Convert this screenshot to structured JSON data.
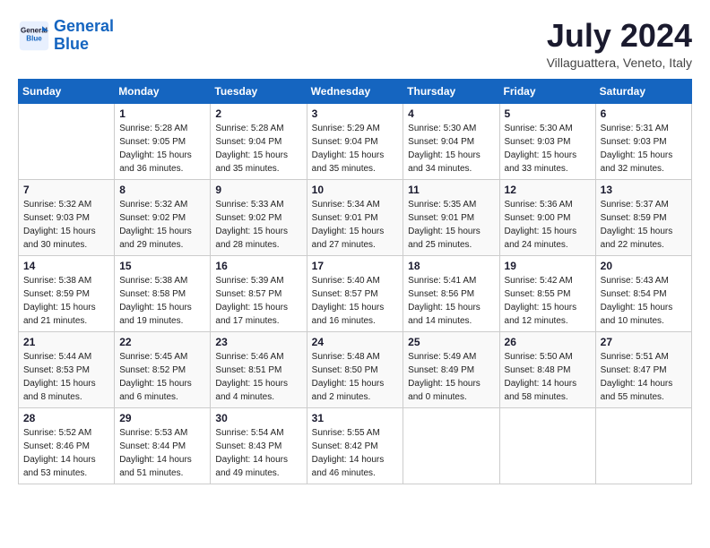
{
  "logo": {
    "line1": "General",
    "line2": "Blue"
  },
  "title": "July 2024",
  "subtitle": "Villaguattera, Veneto, Italy",
  "weekdays": [
    "Sunday",
    "Monday",
    "Tuesday",
    "Wednesday",
    "Thursday",
    "Friday",
    "Saturday"
  ],
  "weeks": [
    [
      {
        "day": "",
        "sunrise": "",
        "sunset": "",
        "daylight": ""
      },
      {
        "day": "1",
        "sunrise": "Sunrise: 5:28 AM",
        "sunset": "Sunset: 9:05 PM",
        "daylight": "Daylight: 15 hours and 36 minutes."
      },
      {
        "day": "2",
        "sunrise": "Sunrise: 5:28 AM",
        "sunset": "Sunset: 9:04 PM",
        "daylight": "Daylight: 15 hours and 35 minutes."
      },
      {
        "day": "3",
        "sunrise": "Sunrise: 5:29 AM",
        "sunset": "Sunset: 9:04 PM",
        "daylight": "Daylight: 15 hours and 35 minutes."
      },
      {
        "day": "4",
        "sunrise": "Sunrise: 5:30 AM",
        "sunset": "Sunset: 9:04 PM",
        "daylight": "Daylight: 15 hours and 34 minutes."
      },
      {
        "day": "5",
        "sunrise": "Sunrise: 5:30 AM",
        "sunset": "Sunset: 9:03 PM",
        "daylight": "Daylight: 15 hours and 33 minutes."
      },
      {
        "day": "6",
        "sunrise": "Sunrise: 5:31 AM",
        "sunset": "Sunset: 9:03 PM",
        "daylight": "Daylight: 15 hours and 32 minutes."
      }
    ],
    [
      {
        "day": "7",
        "sunrise": "Sunrise: 5:32 AM",
        "sunset": "Sunset: 9:03 PM",
        "daylight": "Daylight: 15 hours and 30 minutes."
      },
      {
        "day": "8",
        "sunrise": "Sunrise: 5:32 AM",
        "sunset": "Sunset: 9:02 PM",
        "daylight": "Daylight: 15 hours and 29 minutes."
      },
      {
        "day": "9",
        "sunrise": "Sunrise: 5:33 AM",
        "sunset": "Sunset: 9:02 PM",
        "daylight": "Daylight: 15 hours and 28 minutes."
      },
      {
        "day": "10",
        "sunrise": "Sunrise: 5:34 AM",
        "sunset": "Sunset: 9:01 PM",
        "daylight": "Daylight: 15 hours and 27 minutes."
      },
      {
        "day": "11",
        "sunrise": "Sunrise: 5:35 AM",
        "sunset": "Sunset: 9:01 PM",
        "daylight": "Daylight: 15 hours and 25 minutes."
      },
      {
        "day": "12",
        "sunrise": "Sunrise: 5:36 AM",
        "sunset": "Sunset: 9:00 PM",
        "daylight": "Daylight: 15 hours and 24 minutes."
      },
      {
        "day": "13",
        "sunrise": "Sunrise: 5:37 AM",
        "sunset": "Sunset: 8:59 PM",
        "daylight": "Daylight: 15 hours and 22 minutes."
      }
    ],
    [
      {
        "day": "14",
        "sunrise": "Sunrise: 5:38 AM",
        "sunset": "Sunset: 8:59 PM",
        "daylight": "Daylight: 15 hours and 21 minutes."
      },
      {
        "day": "15",
        "sunrise": "Sunrise: 5:38 AM",
        "sunset": "Sunset: 8:58 PM",
        "daylight": "Daylight: 15 hours and 19 minutes."
      },
      {
        "day": "16",
        "sunrise": "Sunrise: 5:39 AM",
        "sunset": "Sunset: 8:57 PM",
        "daylight": "Daylight: 15 hours and 17 minutes."
      },
      {
        "day": "17",
        "sunrise": "Sunrise: 5:40 AM",
        "sunset": "Sunset: 8:57 PM",
        "daylight": "Daylight: 15 hours and 16 minutes."
      },
      {
        "day": "18",
        "sunrise": "Sunrise: 5:41 AM",
        "sunset": "Sunset: 8:56 PM",
        "daylight": "Daylight: 15 hours and 14 minutes."
      },
      {
        "day": "19",
        "sunrise": "Sunrise: 5:42 AM",
        "sunset": "Sunset: 8:55 PM",
        "daylight": "Daylight: 15 hours and 12 minutes."
      },
      {
        "day": "20",
        "sunrise": "Sunrise: 5:43 AM",
        "sunset": "Sunset: 8:54 PM",
        "daylight": "Daylight: 15 hours and 10 minutes."
      }
    ],
    [
      {
        "day": "21",
        "sunrise": "Sunrise: 5:44 AM",
        "sunset": "Sunset: 8:53 PM",
        "daylight": "Daylight: 15 hours and 8 minutes."
      },
      {
        "day": "22",
        "sunrise": "Sunrise: 5:45 AM",
        "sunset": "Sunset: 8:52 PM",
        "daylight": "Daylight: 15 hours and 6 minutes."
      },
      {
        "day": "23",
        "sunrise": "Sunrise: 5:46 AM",
        "sunset": "Sunset: 8:51 PM",
        "daylight": "Daylight: 15 hours and 4 minutes."
      },
      {
        "day": "24",
        "sunrise": "Sunrise: 5:48 AM",
        "sunset": "Sunset: 8:50 PM",
        "daylight": "Daylight: 15 hours and 2 minutes."
      },
      {
        "day": "25",
        "sunrise": "Sunrise: 5:49 AM",
        "sunset": "Sunset: 8:49 PM",
        "daylight": "Daylight: 15 hours and 0 minutes."
      },
      {
        "day": "26",
        "sunrise": "Sunrise: 5:50 AM",
        "sunset": "Sunset: 8:48 PM",
        "daylight": "Daylight: 14 hours and 58 minutes."
      },
      {
        "day": "27",
        "sunrise": "Sunrise: 5:51 AM",
        "sunset": "Sunset: 8:47 PM",
        "daylight": "Daylight: 14 hours and 55 minutes."
      }
    ],
    [
      {
        "day": "28",
        "sunrise": "Sunrise: 5:52 AM",
        "sunset": "Sunset: 8:46 PM",
        "daylight": "Daylight: 14 hours and 53 minutes."
      },
      {
        "day": "29",
        "sunrise": "Sunrise: 5:53 AM",
        "sunset": "Sunset: 8:44 PM",
        "daylight": "Daylight: 14 hours and 51 minutes."
      },
      {
        "day": "30",
        "sunrise": "Sunrise: 5:54 AM",
        "sunset": "Sunset: 8:43 PM",
        "daylight": "Daylight: 14 hours and 49 minutes."
      },
      {
        "day": "31",
        "sunrise": "Sunrise: 5:55 AM",
        "sunset": "Sunset: 8:42 PM",
        "daylight": "Daylight: 14 hours and 46 minutes."
      },
      {
        "day": "",
        "sunrise": "",
        "sunset": "",
        "daylight": ""
      },
      {
        "day": "",
        "sunrise": "",
        "sunset": "",
        "daylight": ""
      },
      {
        "day": "",
        "sunrise": "",
        "sunset": "",
        "daylight": ""
      }
    ]
  ]
}
